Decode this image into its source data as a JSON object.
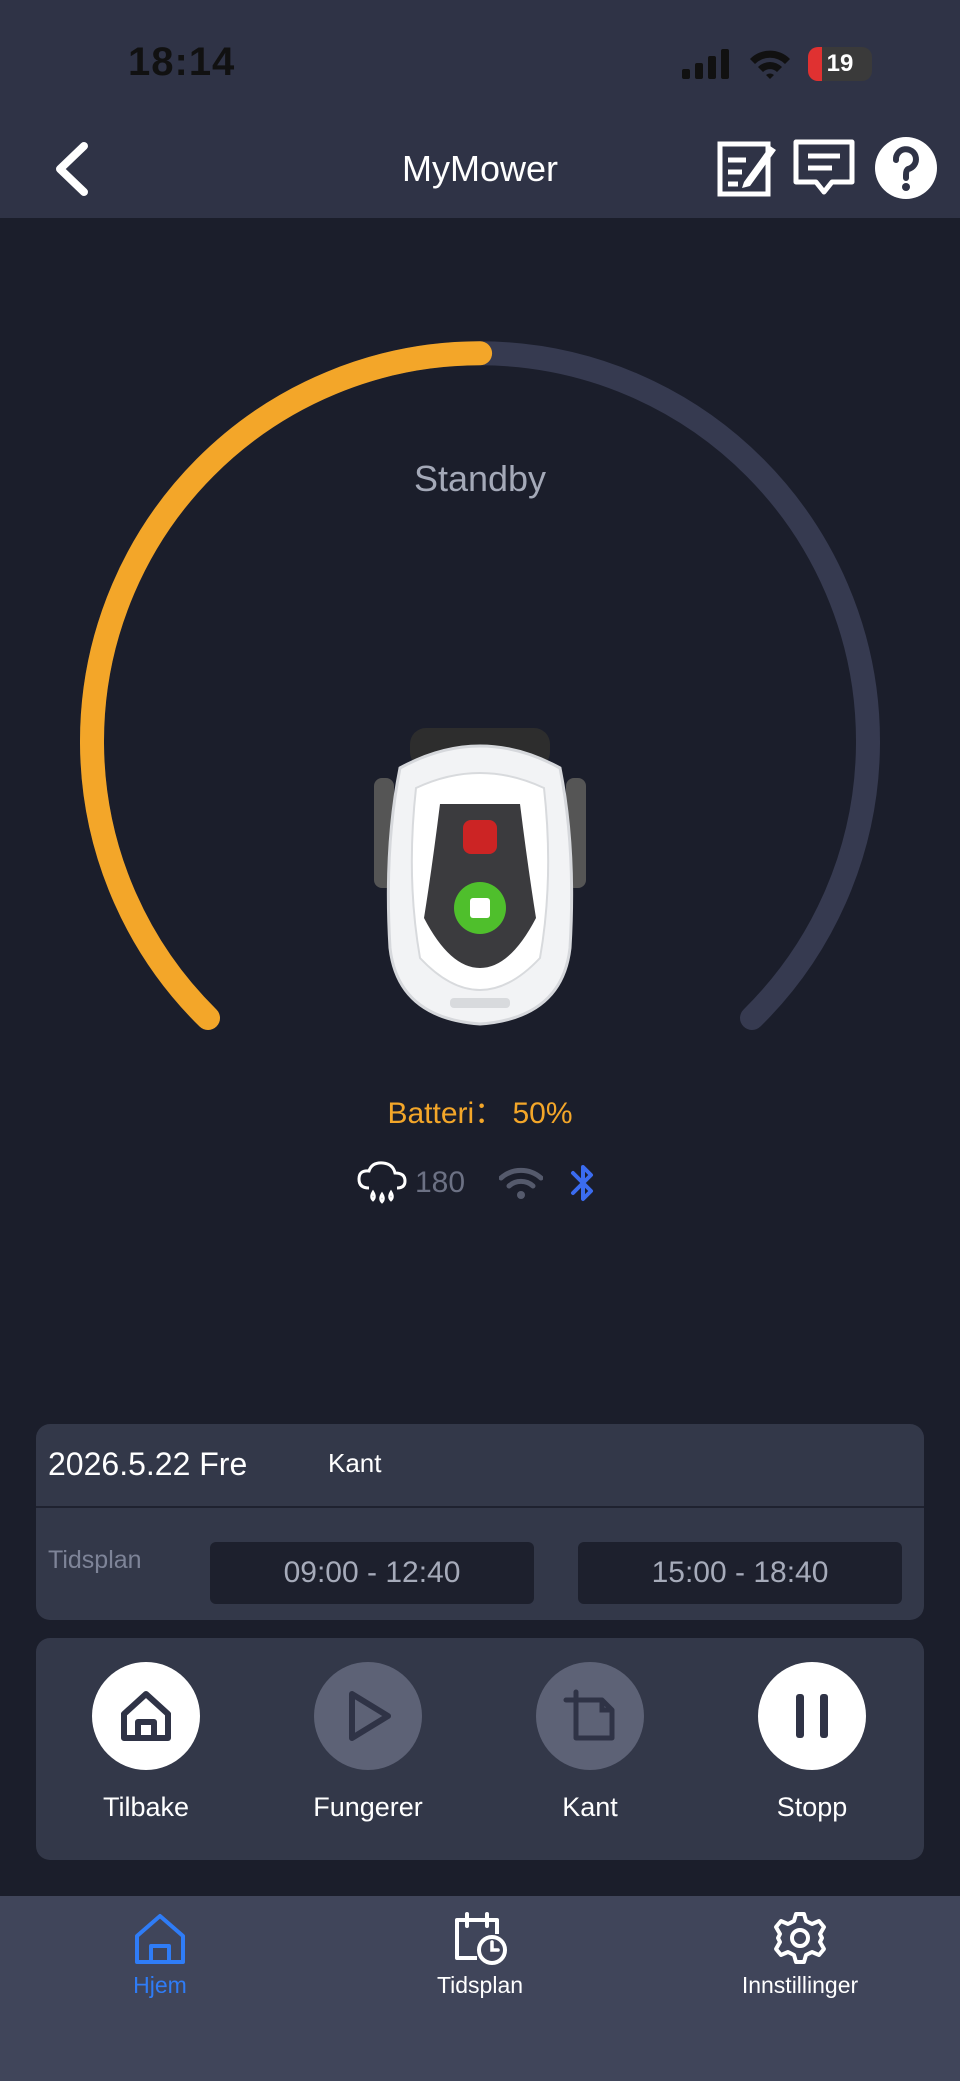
{
  "status_bar": {
    "time": "18:14",
    "battery_level": "19"
  },
  "nav": {
    "title": "MyMower",
    "icons": [
      "back-chevron-icon",
      "edit-note-icon",
      "message-icon",
      "help-icon"
    ]
  },
  "device": {
    "status": "Standby",
    "battery_label": "Batteri： 50%",
    "battery_percent": 50,
    "rain_value": "180",
    "wifi_connected": false,
    "bluetooth_connected": true
  },
  "schedule": {
    "date": "2026.5.22 Fre",
    "mode": "Kant",
    "label": "Tidsplan",
    "slots": [
      "09:00 - 12:40",
      "15:00 - 18:40"
    ]
  },
  "actions": [
    {
      "label": "Tilbake",
      "icon": "home-icon",
      "enabled": true
    },
    {
      "label": "Fungerer",
      "icon": "play-icon",
      "enabled": false
    },
    {
      "label": "Kant",
      "icon": "edge-icon",
      "enabled": false
    },
    {
      "label": "Stopp",
      "icon": "pause-icon",
      "enabled": true
    }
  ],
  "tabs": [
    {
      "label": "Hjem",
      "icon": "home-icon",
      "active": true
    },
    {
      "label": "Tidsplan",
      "icon": "calendar-clock-icon",
      "active": false
    },
    {
      "label": "Innstillinger",
      "icon": "gear-icon",
      "active": false
    }
  ],
  "colors": {
    "accent": "#f3a629",
    "active_tab": "#2f7cf6",
    "bluetooth": "#3b6cf0",
    "track": "#363a50"
  }
}
